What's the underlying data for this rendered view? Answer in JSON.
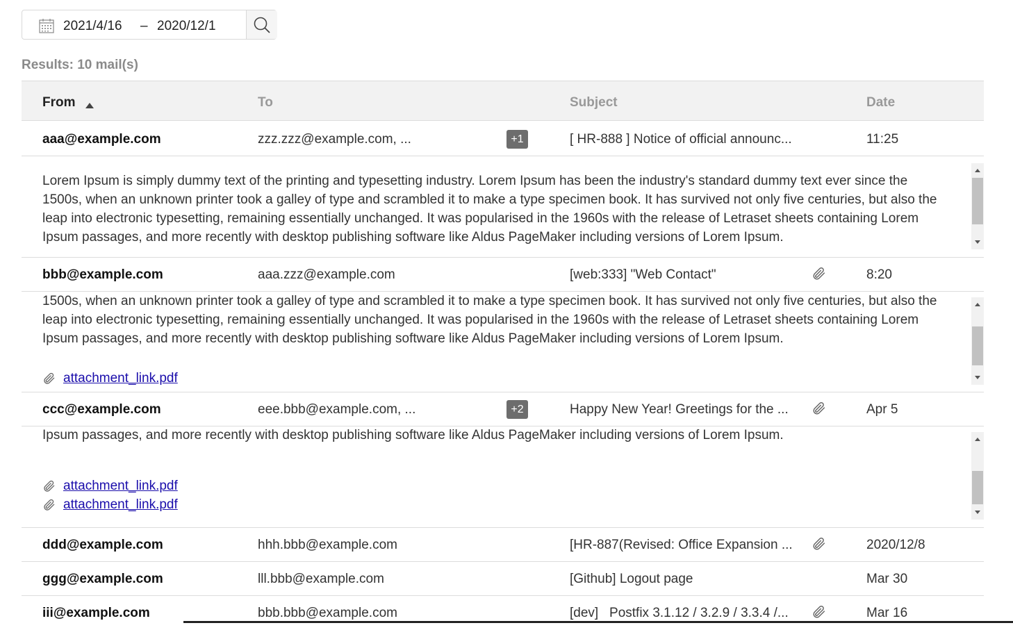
{
  "search": {
    "date_from": "2021/4/16",
    "date_separator": "–",
    "date_to": "2020/12/1"
  },
  "results_label": "Results: 10 mail(s)",
  "columns": {
    "from": "From",
    "to": "To",
    "subject": "Subject",
    "date": "Date"
  },
  "rows": [
    {
      "from": "aaa@example.com",
      "to": "zzz.zzz@example.com, ...",
      "badge": "+1",
      "subject": "[ HR-888 ] Notice of official announc...",
      "date": "11:25"
    },
    {
      "from": "bbb@example.com",
      "to": "aaa.zzz@example.com",
      "subject": "[web:333] \"Web Contact\"",
      "date": "8:20"
    },
    {
      "from": "ccc@example.com",
      "to": "eee.bbb@example.com, ...",
      "badge": "+2",
      "subject": "Happy New Year! Greetings for the ...",
      "date": "Apr 5"
    },
    {
      "from": "ddd@example.com",
      "to": "hhh.bbb@example.com",
      "subject": "[HR-887(Revised: Office Expansion ...",
      "date": "2020/12/8"
    },
    {
      "from": "ggg@example.com",
      "to": "lll.bbb@example.com",
      "subject": "[Github] Logout page",
      "date": "Mar 30"
    },
    {
      "from": "iii@example.com",
      "to": "bbb.bbb@example.com",
      "subject": "[dev]   Postfix 3.1.12 / 3.2.9 / 3.3.4 /...",
      "date": "Mar 16"
    }
  ],
  "preview_body": "Lorem Ipsum is simply dummy text of the printing and typesetting industry. Lorem Ipsum has been the industry's standard dummy text ever since the 1500s, when an unknown printer took a galley of type and scrambled it to make a type specimen book. It has survived not only five centuries, but also the leap into electronic typesetting, remaining essentially unchanged. It was popularised in the 1960s with the release of Letraset sheets containing Lorem Ipsum passages, and more recently with desktop publishing software like Aldus PageMaker including versions of Lorem Ipsum.",
  "attachment_name": "attachment_link.pdf",
  "icons": {
    "calendar": "calendar-icon",
    "search": "search-icon",
    "attachment": "paperclip-icon",
    "sort": "sort-ascending-icon"
  }
}
